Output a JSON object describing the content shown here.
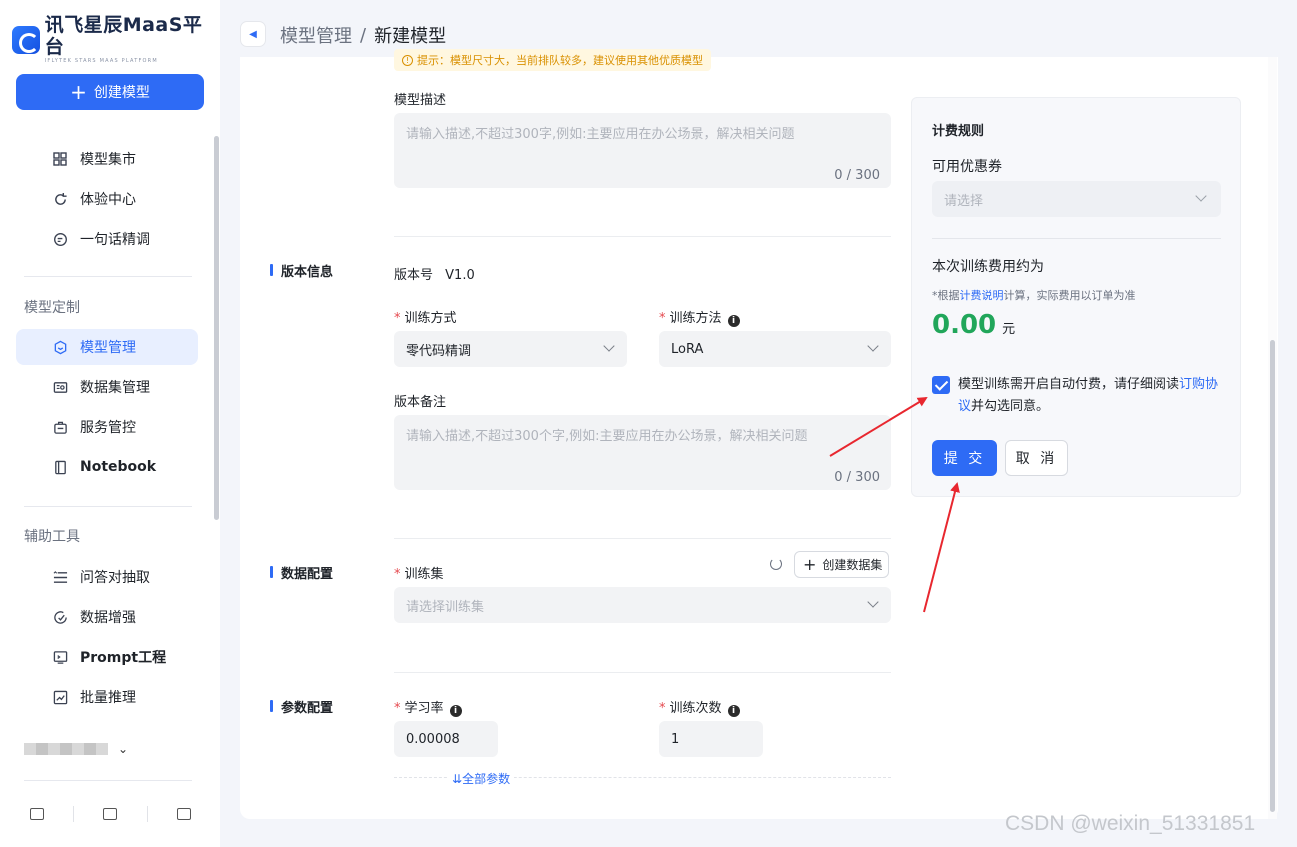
{
  "logo": {
    "name": "讯飞星辰MaaS平台",
    "subtitle": "IFLYTEK STARS MAAS PLATFORM"
  },
  "sidebar": {
    "create_button": "创建模型",
    "top_items": [
      {
        "label": "模型集市",
        "icon": "grid-icon"
      },
      {
        "label": "体验中心",
        "icon": "refresh-icon"
      },
      {
        "label": "一句话精调",
        "icon": "chat-circle-icon"
      }
    ],
    "section_model": "模型定制",
    "model_items": [
      {
        "label": "模型管理",
        "icon": "cube-icon",
        "active": true
      },
      {
        "label": "数据集管理",
        "icon": "dataset-icon"
      },
      {
        "label": "服务管控",
        "icon": "service-icon"
      },
      {
        "label": "Notebook",
        "icon": "notebook-icon"
      }
    ],
    "section_tools": "辅助工具",
    "tool_items": [
      {
        "label": "问答对抽取",
        "icon": "list-icon"
      },
      {
        "label": "数据增强",
        "icon": "boost-icon"
      },
      {
        "label": "Prompt工程",
        "icon": "prompt-icon"
      },
      {
        "label": "批量推理",
        "icon": "chart-icon"
      }
    ]
  },
  "header": {
    "crumb_parent": "模型管理",
    "crumb_sep": "/",
    "crumb_current": "新建模型"
  },
  "form": {
    "tip": "提示：模型尺寸大，当前排队较多，建议使用其他优质模型",
    "desc_label": "模型描述",
    "desc_placeholder": "请输入描述,不超过300字,例如:主要应用在办公场景，解决相关问题",
    "desc_count": "0 / 300",
    "version_section": "版本信息",
    "version_label": "版本号",
    "version_value": "V1.0",
    "train_mode_label": "训练方式",
    "train_mode_value": "零代码精调",
    "train_method_label": "训练方法",
    "train_method_value": "LoRA",
    "remark_label": "版本备注",
    "remark_placeholder": "请输入描述,不超过300个字,例如:主要应用在办公场景，解决相关问题",
    "remark_count": "0 / 300",
    "data_section": "数据配置",
    "trainset_label": "训练集",
    "create_dataset": "创建数据集",
    "trainset_placeholder": "请选择训练集",
    "param_section": "参数配置",
    "lr_label": "学习率",
    "lr_value": "0.00008",
    "epochs_label": "训练次数",
    "epochs_value": "1",
    "all_params": "全部参数"
  },
  "billing": {
    "title": "计费规则",
    "coupon_label": "可用优惠券",
    "coupon_placeholder": "请选择",
    "fee_label": "本次训练费用约为",
    "note_prefix": "*根据",
    "note_link": "计费说明",
    "note_suffix": "计算，实际费用以订单为准",
    "amount": "0.00",
    "unit": "元",
    "agree_text": "模型训练需开启自动付费，请仔细阅读",
    "agree_link": "订购协议",
    "agree_suffix": "并勾选同意。",
    "agree_checked": true,
    "submit": "提 交",
    "cancel": "取 消"
  },
  "watermark": "CSDN @weixin_51331851",
  "colors": {
    "primary": "#2e6bf5",
    "fee_green": "#21a65a",
    "annotation_red": "#e8272f",
    "tip_bg": "#fff7e0"
  }
}
